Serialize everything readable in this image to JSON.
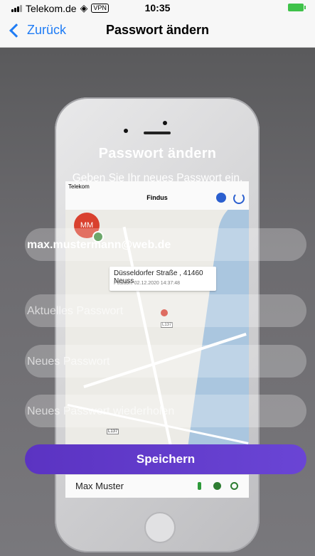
{
  "status_bar": {
    "carrier": "Telekom.de",
    "vpn": "VPN",
    "time": "10:35"
  },
  "nav": {
    "back_label": "Zurück",
    "title": "Passwort ändern"
  },
  "overlay": {
    "title": "Passwort ändern",
    "subtitle": "Geben Sie Ihr neues Passwort ein.",
    "email_value": "max.mustermann@web.de",
    "current_password_placeholder": "Aktuelles Passwort",
    "new_password_placeholder": "Neues Passwort",
    "repeat_password_placeholder": "Neues Passwort wiederholen",
    "save_label": "Speichern"
  },
  "background_phone": {
    "status_carrier": "Telekom",
    "app_title": "Findus",
    "avatar_initials": "MM",
    "callout_address": "Düsseldorfer Straße , 41460 Neuss",
    "callout_position": "Position: 02.12.2020 14:37:48",
    "road_label_1": "L137",
    "road_label_2": "L137",
    "tab_user_name": "Max Muster"
  },
  "colors": {
    "accent": "#1f7cf5",
    "save_button": "#5b33c2",
    "battery": "#3fc24a"
  }
}
